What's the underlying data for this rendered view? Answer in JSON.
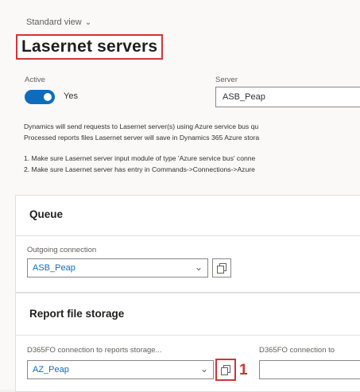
{
  "header": {
    "view_label": "Standard view",
    "title": "Lasernet servers"
  },
  "fields": {
    "active_label": "Active",
    "active_value": "Yes",
    "server_label": "Server",
    "server_value": "ASB_Peap"
  },
  "info": {
    "line1": "Dynamics will send requests to Lasernet server(s) using Azure service bus qu",
    "line2": "Processed reports files Lasernet server will save in Dynamics 365 Azure stora",
    "step1": "1. Make sure Lasernet server input module of type 'Azure service bus' conne",
    "step2": "2. Make sure Lasernet server has entry in Commands->Connections->Azure"
  },
  "queue": {
    "title": "Queue",
    "outgoing_label": "Outgoing connection",
    "outgoing_value": "ASB_Peap"
  },
  "storage": {
    "title": "Report file storage",
    "conn_label": "D365FO connection to reports storage...",
    "conn_value": "AZ_Peap",
    "conn2_label": "D365FO connection to"
  },
  "annotation": {
    "marker": "1",
    "color": "#d13438"
  },
  "colors": {
    "accent": "#0f6cbd",
    "highlight": "#d13438"
  }
}
